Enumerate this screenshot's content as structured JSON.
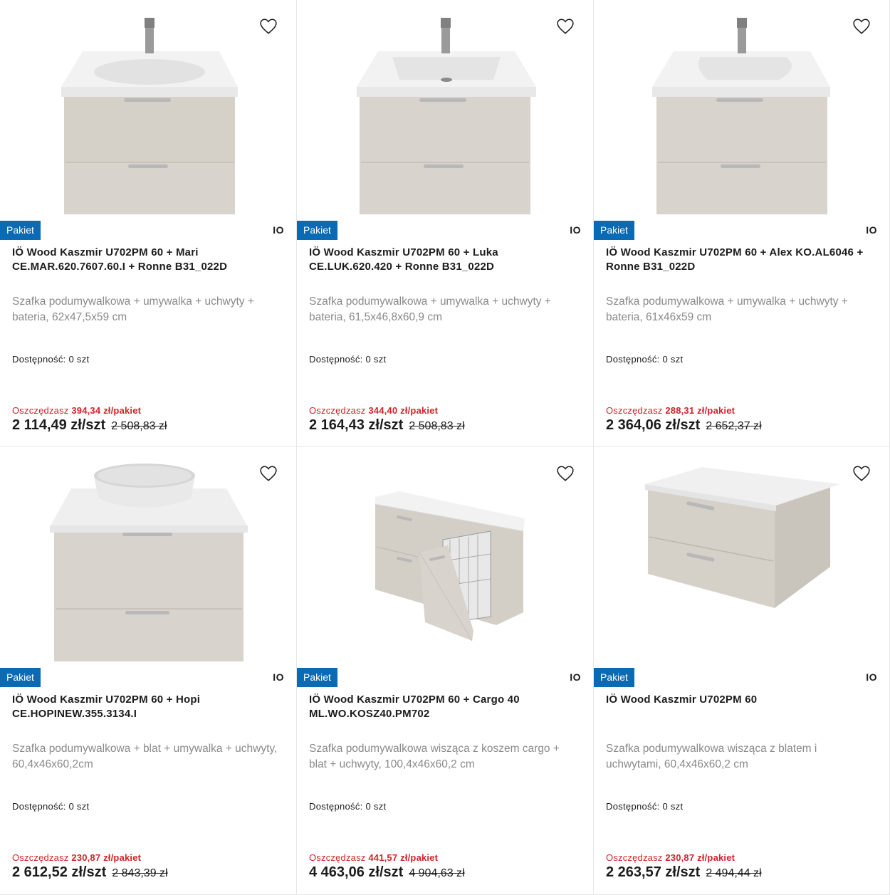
{
  "products": [
    {
      "badge": "Pakiet",
      "brand": "IO",
      "title": "IÖ Wood Kaszmir U702PM 60 + Mari CE.MAR.620.7607.60.I + Ronne B31_022D",
      "description": "Szafka podumywalkowa + umywalka + uchwyty + bateria, 62x47,5x59 cm",
      "availability": "Dostępność: 0 szt",
      "savings_label": "Oszczędzasz",
      "savings_value": "394,34 zł/pakiet",
      "price": "2 114,49 zł/szt",
      "old_price": "2 508,83 zł",
      "image_icon": "vanity-with-basin-and-faucet-icon"
    },
    {
      "badge": "Pakiet",
      "brand": "IO",
      "title": "IÖ Wood Kaszmir U702PM 60 + Luka CE.LUK.620.420 + Ronne B31_022D",
      "description": "Szafka podumywalkowa + umywalka + uchwyty + bateria, 61,5x46,8x60,9 cm",
      "availability": "Dostępność: 0 szt",
      "savings_label": "Oszczędzasz",
      "savings_value": "344,40 zł/pakiet",
      "price": "2 164,43 zł/szt",
      "old_price": "2 508,83 zł",
      "image_icon": "vanity-with-basin-and-faucet-icon"
    },
    {
      "badge": "Pakiet",
      "brand": "IO",
      "title": "IÖ Wood Kaszmir U702PM 60 + Alex KO.AL6046 + Ronne B31_022D",
      "description": "Szafka podumywalkowa + umywalka + uchwyty + bateria, 61x46x59 cm",
      "availability": "Dostępność: 0 szt",
      "savings_label": "Oszczędzasz",
      "savings_value": "288,31 zł/pakiet",
      "price": "2 364,06 zł/szt",
      "old_price": "2 652,37 zł",
      "image_icon": "vanity-with-basin-and-faucet-icon"
    },
    {
      "badge": "Pakiet",
      "brand": "IO",
      "title": "IÖ Wood Kaszmir U702PM 60 + Hopi CE.HOPINEW.355.3134.I",
      "description": "Szafka podumywalkowa + blat + umywalka + uchwyty, 60,4x46x60,2cm",
      "availability": "Dostępność: 0 szt",
      "savings_label": "Oszczędzasz",
      "savings_value": "230,87 zł/pakiet",
      "price": "2 612,52 zł/szt",
      "old_price": "2 843,39 zł",
      "image_icon": "vanity-with-bowl-basin-icon"
    },
    {
      "badge": "Pakiet",
      "brand": "IO",
      "title": "IÖ Wood Kaszmir U702PM 60 + Cargo 40 ML.WO.KOSZ40.PM702",
      "description": "Szafka podumywalkowa wisząca z koszem cargo + blat + uchwyty, 100,4x46x60,2 cm",
      "availability": "Dostępność: 0 szt",
      "savings_label": "Oszczędzasz",
      "savings_value": "441,57 zł/pakiet",
      "price": "4 463,06 zł/szt",
      "old_price": "4 904,63 zł",
      "image_icon": "vanity-with-cargo-basket-icon"
    },
    {
      "badge": "Pakiet",
      "brand": "IO",
      "title": "IÖ Wood Kaszmir U702PM 60",
      "description": "Szafka podumywalkowa wisząca z blatem i uchwytami, 60,4x46x60,2 cm",
      "availability": "Dostępność: 0 szt",
      "savings_label": "Oszczędzasz",
      "savings_value": "230,87 zł/pakiet",
      "price": "2 263,57 zł/szt",
      "old_price": "2 494,44 zł",
      "image_icon": "vanity-with-countertop-icon"
    }
  ],
  "colors": {
    "badge_bg": "#0a6ab3",
    "savings_red": "#d1232a",
    "cabinet_cashmere": "#d8d3cc",
    "border": "#e6e6e6"
  }
}
